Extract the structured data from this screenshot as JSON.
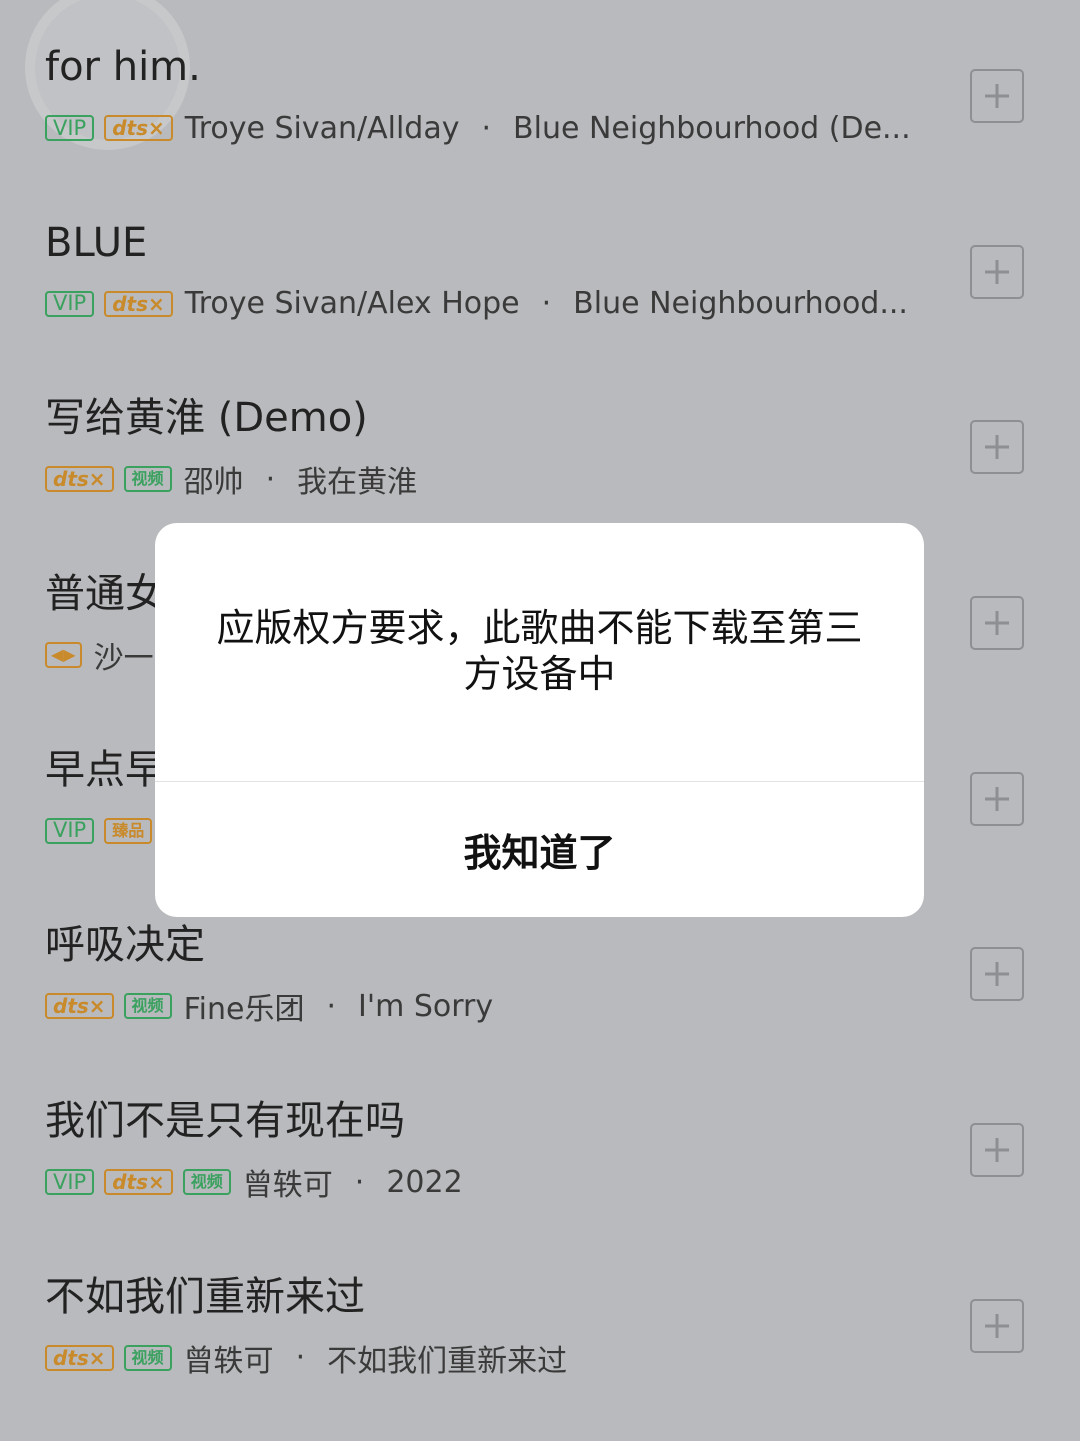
{
  "songs": [
    {
      "title": "for him.",
      "badges": [
        {
          "type": "vip",
          "label": "VIP"
        },
        {
          "type": "dts",
          "label": "dts×"
        }
      ],
      "artist": "Troye Sivan/Allday",
      "album": "Blue Neighbourhood (De..."
    },
    {
      "title": "BLUE",
      "badges": [
        {
          "type": "vip",
          "label": "VIP"
        },
        {
          "type": "dts",
          "label": "dts×"
        }
      ],
      "artist": "Troye Sivan/Alex Hope",
      "album": "Blue Neighbourhood..."
    },
    {
      "title": "写给黄淮 (Demo)",
      "badges": [
        {
          "type": "dts",
          "label": "dts×"
        },
        {
          "type": "video",
          "label": "视频"
        }
      ],
      "artist": "邵帅",
      "album": "我在黄淮"
    },
    {
      "title": "普通女",
      "badges": [
        {
          "type": "mv",
          "label": "◀▶"
        }
      ],
      "artist": "沙一",
      "album": ""
    },
    {
      "title": "早点早",
      "badges": [
        {
          "type": "vip",
          "label": "VIP"
        },
        {
          "type": "hq",
          "label": "臻品"
        }
      ],
      "artist": "",
      "album": ""
    },
    {
      "title": "呼吸决定",
      "badges": [
        {
          "type": "dts",
          "label": "dts×"
        },
        {
          "type": "video",
          "label": "视频"
        }
      ],
      "artist": "Fine乐团",
      "album": "I'm Sorry"
    },
    {
      "title": "我们不是只有现在吗",
      "badges": [
        {
          "type": "vip",
          "label": "VIP"
        },
        {
          "type": "dts",
          "label": "dts×"
        },
        {
          "type": "video",
          "label": "视频"
        }
      ],
      "artist": "曾轶可",
      "album": "2022"
    },
    {
      "title": "不如我们重新来过",
      "badges": [
        {
          "type": "dts",
          "label": "dts×"
        },
        {
          "type": "video",
          "label": "视频"
        }
      ],
      "artist": "曾轶可",
      "album": "不如我们重新来过"
    }
  ],
  "dialog": {
    "message": "应版权方要求，此歌曲不能下载至第三方设备中",
    "confirm_label": "我知道了"
  },
  "icons": {
    "add": "plus-icon"
  },
  "colors": {
    "overlay_bg": "#b9babd",
    "vip_green": "#3aa15f",
    "dts_gold": "#c88a2a"
  }
}
